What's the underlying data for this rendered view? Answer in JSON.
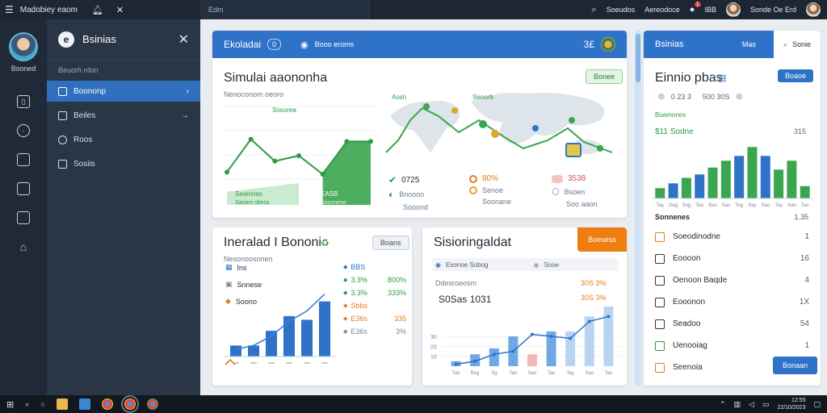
{
  "topbar": {
    "app_title": "Madobiey eaom",
    "tab_label": "Edm",
    "search_label": "Soeudos",
    "account_label": "Aereodoce",
    "notification_count": "1",
    "menu_label": "IBB",
    "user_label": "Sonde Oe Erd"
  },
  "rail": {
    "user_name": "Bsoned"
  },
  "sidenav": {
    "title": "Bsinias",
    "section_label": "Beuorh rdon",
    "items": [
      {
        "label": "Boononp",
        "active": true
      },
      {
        "label": "Beiles"
      },
      {
        "label": "Roos"
      },
      {
        "label": "Sosiis"
      }
    ]
  },
  "card1": {
    "header_title": "Ekoladai",
    "header_chip": "0",
    "header_link": "Booo eroms",
    "header_count": "3£",
    "title": "Simulai aaononha",
    "subtitle": "Nenoconom oeoro",
    "button": "Bonee",
    "peak_label": "Sosorea",
    "area_label_left": "Seamnes",
    "area_label_right": "EASB",
    "area_value_left": "Saoam sbess",
    "area_value_right": "Sooonene",
    "map_label_left": "Aosh",
    "map_label_right": "Seoorb",
    "stats": [
      {
        "value": "0725",
        "sub": "Bnooon",
        "sub2": "Sooond",
        "color": "#2f9a44"
      },
      {
        "value": "80%",
        "sub": "Senoe",
        "sub2": "Soonane",
        "color": "#e0801a"
      },
      {
        "value": "3538",
        "sub": "Bsoen",
        "sub2": "Soo aaon",
        "color": "#d35454"
      }
    ]
  },
  "card2": {
    "title": "Ineralad I Bononi",
    "button": "Boans",
    "subtitle": "Nesonoosonen",
    "legend": [
      {
        "label": "Ins",
        "color": "#2f73c9"
      },
      {
        "label": "Snnese",
        "color": "#7a8898"
      },
      {
        "label": "Soono",
        "color": "#e0801a"
      }
    ],
    "right_list": [
      {
        "label": "BBS",
        "value": "",
        "color": "#2f73c9"
      },
      {
        "label": "3.3%",
        "value": "800%",
        "color": "#2f9a44"
      },
      {
        "label": "3.3%",
        "value": "333%",
        "color": "#2f9a44"
      },
      {
        "label": "Sbbs",
        "value": "",
        "color": "#e0801a"
      },
      {
        "label": "E36s",
        "value": "335",
        "color": "#e0801a"
      },
      {
        "label": "E36s",
        "value": "3%",
        "color": "#7a8898"
      }
    ]
  },
  "card3": {
    "title": "Sisioringaldat",
    "button": "Boesess",
    "legend_left": "Esonoe Sobog",
    "legend_right": "Sooe",
    "subtitle": "Ddesroeosm",
    "value_left": "30S 3%",
    "value_right": "30S 3%",
    "big_value": "S0Sas 1031"
  },
  "card4": {
    "header_title": "Bsinias",
    "header_tab": "Mas",
    "header_search": "Sonie",
    "title": "Einnio pbas",
    "button": "Boaoe",
    "stat1": "0 23 3",
    "stat2": "500 30S",
    "section_label": "Boamones",
    "sub_value_left": "$11 Sodne",
    "sub_value_right": "315",
    "list_header": "Sonnenes",
    "list_header_value": "1.35",
    "list": [
      {
        "label": "Soeodinodne",
        "value": "1",
        "icon": "#e0801a"
      },
      {
        "label": "Eoooon",
        "value": "16",
        "icon": "#333333"
      },
      {
        "label": "Oenoon Baqde",
        "value": "4",
        "icon": "#333333"
      },
      {
        "label": "Eooonon",
        "value": "1X",
        "icon": "#333333"
      },
      {
        "label": "Seadoo",
        "value": "54",
        "icon": "#333333"
      },
      {
        "label": "Uenooiag",
        "value": "1",
        "icon": "#2f9a44"
      },
      {
        "label": "Seenoia",
        "value": "",
        "icon": "#e0801a"
      }
    ],
    "bottom_button": "Bonaan"
  },
  "taskbar": {
    "time": "12:55",
    "date": "22/10/2023"
  },
  "chart_data": [
    {
      "type": "line",
      "title": "Simulai aaononha",
      "y": [
        30,
        60,
        40,
        45,
        28,
        58,
        58
      ],
      "ylim": [
        0,
        90
      ],
      "area_right": [
        30,
        58,
        58
      ]
    },
    {
      "type": "bar",
      "title": "Ineralad I Bononi",
      "categories": [
        "",
        "",
        "",
        "",
        "",
        ""
      ],
      "values": [
        15,
        15,
        35,
        55,
        50,
        75
      ],
      "line": [
        10,
        15,
        28,
        48,
        62,
        85
      ],
      "ylim": [
        0,
        90
      ]
    },
    {
      "type": "bar",
      "title": "Sisioringaldat",
      "categories": [
        "Tao",
        "Bog",
        "Sg",
        "Tao",
        "Sao",
        "Tao",
        "Tay",
        "Sao",
        "Tao"
      ],
      "values": [
        5,
        12,
        18,
        30,
        12,
        35,
        35,
        50,
        60
      ],
      "colors": [
        "#6ea8e6",
        "#6ea8e6",
        "#6ea8e6",
        "#6ea8e6",
        "#f2b8b8",
        "#6ea8e6",
        "#b9d4f1",
        "#b9d4f1",
        "#b9d4f1"
      ],
      "line": [
        2,
        5,
        12,
        15,
        32,
        30,
        28,
        45,
        50
      ],
      "yticks": [
        10,
        20,
        30
      ],
      "ylim": [
        0,
        60
      ]
    },
    {
      "type": "bar",
      "title": "Einnio pbas",
      "categories": [
        "Tay",
        "Dag",
        "Sog",
        "Tao",
        "Bao",
        "Sao",
        "Tog",
        "Say",
        "Sao",
        "Tay",
        "Sao",
        "Tao"
      ],
      "values": [
        15,
        22,
        30,
        35,
        45,
        55,
        62,
        75,
        62,
        42,
        55,
        18
      ],
      "colors": [
        "#3aa64f",
        "#2f73c9",
        "#3aa64f",
        "#2f73c9",
        "#3aa64f",
        "#3aa64f",
        "#2f73c9",
        "#3aa64f",
        "#2f73c9",
        "#3aa64f",
        "#3aa64f",
        "#3aa64f"
      ],
      "ylim": [
        0,
        80
      ]
    }
  ]
}
